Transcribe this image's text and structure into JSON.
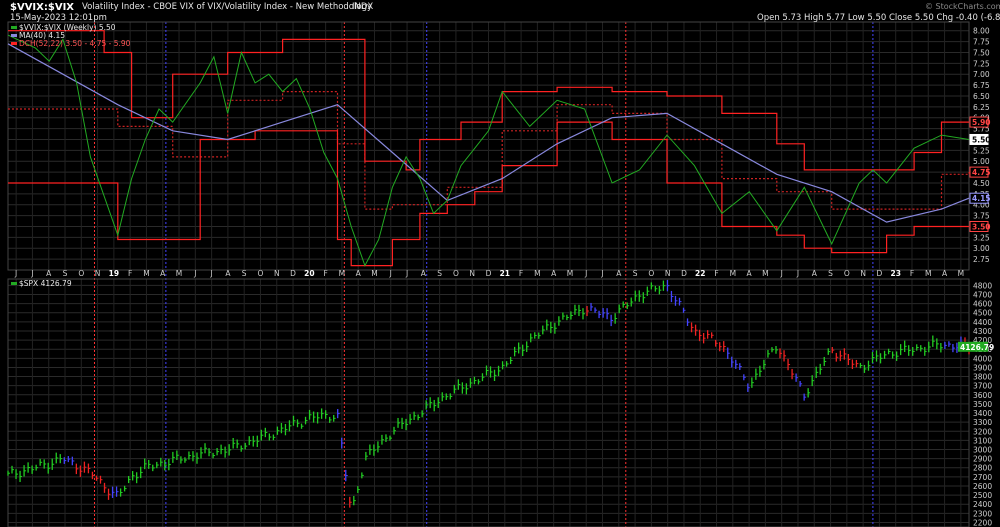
{
  "header": {
    "title_symbol": "$VVIX:$VIX",
    "title_desc": "Volatility Index - CBOE VIX of VIX/Volatility Index - New Methodology",
    "title_tag": "INDX",
    "date": "15-May-2023 12:01pm",
    "ohlc": "Open 5.73  High 5.77  Low 5.50  Close 5.50  Chg -0.40 (-6.83%)",
    "watermark": "© StockCharts.com"
  },
  "legend": {
    "series1": "$VVIX:$VIX (Weekly) 5.50",
    "series2": "MA(40) 4.15",
    "series3": "DCH(52,22) 3.50 - 4.75 - 5.90",
    "lower": "$SPX 4126.79"
  },
  "chart_data": [
    {
      "type": "line",
      "title": "$VVIX:$VIX",
      "ylim": [
        2.5,
        8.2
      ],
      "yticks": [
        2.75,
        3.0,
        3.25,
        3.5,
        3.75,
        4.0,
        4.25,
        4.5,
        4.75,
        5.0,
        5.25,
        5.5,
        5.75,
        6.0,
        6.25,
        6.5,
        6.75,
        7.0,
        7.25,
        7.5,
        7.75,
        8.0
      ],
      "value_labels": [
        "5.90",
        "5.50",
        "4.75",
        "4.15",
        "3.50"
      ],
      "value_label_colors": [
        "#ff4444",
        "#ffffff",
        "#ff4444",
        "#9999ff",
        "#ff4444"
      ],
      "series": [
        {
          "name": "$VVIX:$VIX (Weekly)",
          "color": "#22aa22",
          "x": [
            0,
            2,
            3,
            4,
            5,
            6,
            8,
            9,
            10,
            11,
            12,
            14,
            15,
            16,
            17,
            18,
            19,
            20,
            21,
            22,
            23,
            24,
            25,
            26,
            27,
            28,
            29,
            30,
            31,
            32,
            33,
            34,
            35,
            36,
            38,
            40,
            42,
            44,
            46,
            48,
            50,
            52,
            54,
            56,
            58,
            60,
            62,
            63,
            64,
            65,
            66,
            68,
            70
          ],
          "values": [
            7.9,
            7.6,
            7.3,
            7.8,
            6.8,
            5.1,
            3.3,
            4.6,
            5.5,
            6.2,
            5.9,
            6.8,
            7.4,
            6.1,
            7.5,
            6.8,
            7.0,
            6.6,
            6.9,
            6.2,
            5.2,
            4.6,
            3.5,
            2.6,
            3.2,
            4.4,
            5.1,
            4.6,
            3.8,
            4.1,
            4.9,
            5.3,
            5.7,
            6.6,
            5.8,
            6.4,
            6.2,
            4.5,
            4.8,
            5.6,
            4.9,
            3.8,
            4.3,
            3.4,
            4.4,
            3.1,
            4.5,
            4.8,
            4.5,
            4.9,
            5.3,
            5.6,
            5.5
          ]
        },
        {
          "name": "MA(40)",
          "color": "#8888dd",
          "x": [
            0,
            4,
            8,
            12,
            16,
            20,
            24,
            28,
            32,
            36,
            40,
            44,
            48,
            52,
            56,
            60,
            64,
            68,
            70
          ],
          "values": [
            7.7,
            7.0,
            6.3,
            5.7,
            5.5,
            5.9,
            6.3,
            5.2,
            4.1,
            4.6,
            5.4,
            6.0,
            6.1,
            5.4,
            4.7,
            4.3,
            3.6,
            3.9,
            4.15
          ]
        },
        {
          "name": "DCH upper",
          "color": "#ff2222",
          "x": [
            0,
            6,
            7,
            9,
            12,
            16,
            20,
            24,
            26,
            29,
            30,
            33,
            36,
            40,
            44,
            48,
            52,
            56,
            58,
            62,
            66,
            68,
            70
          ],
          "values": [
            8.0,
            8.0,
            7.5,
            6.0,
            7.0,
            7.5,
            7.8,
            7.8,
            5.0,
            4.8,
            5.5,
            5.9,
            6.6,
            6.7,
            6.6,
            6.5,
            6.1,
            5.4,
            4.8,
            4.8,
            5.2,
            5.9,
            5.9
          ]
        },
        {
          "name": "DCH lower",
          "color": "#ff2222",
          "x": [
            0,
            6,
            8,
            12,
            14,
            18,
            24,
            25,
            26,
            28,
            30,
            32,
            34,
            36,
            40,
            44,
            48,
            52,
            56,
            58,
            60,
            62,
            64,
            66,
            68,
            70
          ],
          "values": [
            4.5,
            4.5,
            3.2,
            3.2,
            5.5,
            5.7,
            3.2,
            2.6,
            2.6,
            3.2,
            3.8,
            4.0,
            4.3,
            4.9,
            5.9,
            5.5,
            4.5,
            3.5,
            3.3,
            3.0,
            2.9,
            2.9,
            3.3,
            3.5,
            3.5,
            3.5
          ]
        },
        {
          "name": "DCH middle",
          "color": "#cc2222",
          "x": [
            0,
            8,
            12,
            16,
            20,
            24,
            26,
            28,
            32,
            36,
            40,
            44,
            48,
            52,
            56,
            60,
            64,
            68,
            70
          ],
          "values": [
            6.2,
            5.8,
            5.1,
            6.4,
            6.6,
            5.4,
            3.9,
            4.0,
            4.4,
            5.7,
            6.3,
            6.1,
            5.5,
            4.6,
            4.3,
            3.9,
            3.9,
            4.7,
            4.75
          ]
        }
      ],
      "categories": [
        "J",
        "J",
        "A",
        "S",
        "O",
        "N",
        "19",
        "F",
        "M",
        "A",
        "M",
        "J",
        "J",
        "A",
        "S",
        "O",
        "N",
        "D",
        "20",
        "F",
        "M",
        "A",
        "M",
        "J",
        "J",
        "A",
        "S",
        "O",
        "N",
        "D",
        "21",
        "F",
        "M",
        "A",
        "M",
        "J",
        "J",
        "A",
        "S",
        "O",
        "N",
        "D",
        "22",
        "F",
        "M",
        "A",
        "M",
        "J",
        "J",
        "A",
        "S",
        "O",
        "N",
        "D",
        "23",
        "F",
        "M",
        "A",
        "M"
      ],
      "bold_categories": [
        6,
        18,
        30,
        42,
        54
      ]
    },
    {
      "type": "bar",
      "title": "$SPX",
      "ylim": [
        2150,
        4870
      ],
      "yticks": [
        2200,
        2300,
        2400,
        2500,
        2600,
        2700,
        2800,
        2900,
        3000,
        3100,
        3200,
        3300,
        3400,
        3500,
        3600,
        3700,
        3800,
        3900,
        4000,
        4100,
        4200,
        4300,
        4400,
        4500,
        4600,
        4700,
        4800
      ],
      "value_labels": [
        "4126.79"
      ],
      "series": [
        {
          "name": "$SPX",
          "x": [
            0,
            2,
            4,
            6,
            7,
            8,
            9,
            10,
            12,
            14,
            16,
            18,
            20,
            22,
            24,
            25,
            26,
            27,
            28,
            30,
            32,
            34,
            36,
            38,
            40,
            42,
            44,
            46,
            48,
            50,
            52,
            54,
            56,
            58,
            60,
            62,
            64,
            66,
            68,
            70
          ],
          "values": [
            2720,
            2800,
            2900,
            2750,
            2600,
            2480,
            2700,
            2800,
            2880,
            2950,
            3000,
            3100,
            3220,
            3350,
            3380,
            2300,
            2900,
            3050,
            3200,
            3400,
            3600,
            3750,
            3900,
            4200,
            4400,
            4550,
            4450,
            4700,
            4800,
            4300,
            4150,
            3700,
            4150,
            3600,
            4100,
            3900,
            4050,
            4100,
            4150,
            4126.79
          ]
        }
      ]
    }
  ]
}
